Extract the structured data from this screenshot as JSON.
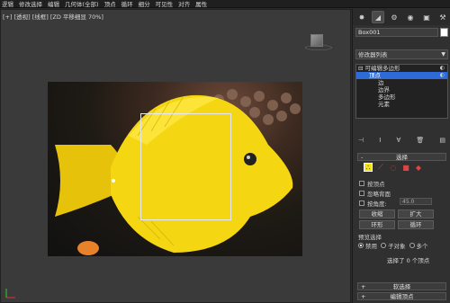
{
  "menu": [
    "逻辑",
    "修改选择",
    "编辑",
    "几何体(全部)",
    "顶点",
    "循环",
    "细分",
    "可见性",
    "对齐",
    "属性"
  ],
  "viewport": {
    "label": "[+] [透视] [线框] [ZD 平移细显 70%]"
  },
  "panel": {
    "tab_icons": [
      "create-icon",
      "modify-icon",
      "hierarchy-icon",
      "motion-icon",
      "display-icon",
      "utilities-icon"
    ],
    "object_name": "Box001",
    "object_color": "#ffffff",
    "modifier_list": "修改器列表",
    "stack": [
      {
        "label": "可编辑多边形",
        "selected": false
      },
      {
        "label": "顶点",
        "selected": true
      },
      {
        "label": "边",
        "selected": false
      },
      {
        "label": "边界",
        "selected": false
      },
      {
        "label": "多边形",
        "selected": false
      },
      {
        "label": "元素",
        "selected": false
      }
    ],
    "selection_rollout": "选择",
    "checkboxes": {
      "by_vertex": "按顶点",
      "ignore_backfacing": "忽略背面",
      "by_angle": "按角度:",
      "angle_value": "45.0"
    },
    "buttons": {
      "shrink": "收缩",
      "grow": "扩大",
      "ring": "环形",
      "loop": "循环"
    },
    "preview": {
      "label": "预览选择",
      "options": [
        "禁用",
        "子对象",
        "多个"
      ],
      "selected": "禁用"
    },
    "status": "选择了 0 个顶点",
    "soft_selection": "软选择",
    "edit_vertices": "编辑顶点"
  },
  "accent": "#2f6bd6",
  "vertex_color": "#f1e21b"
}
